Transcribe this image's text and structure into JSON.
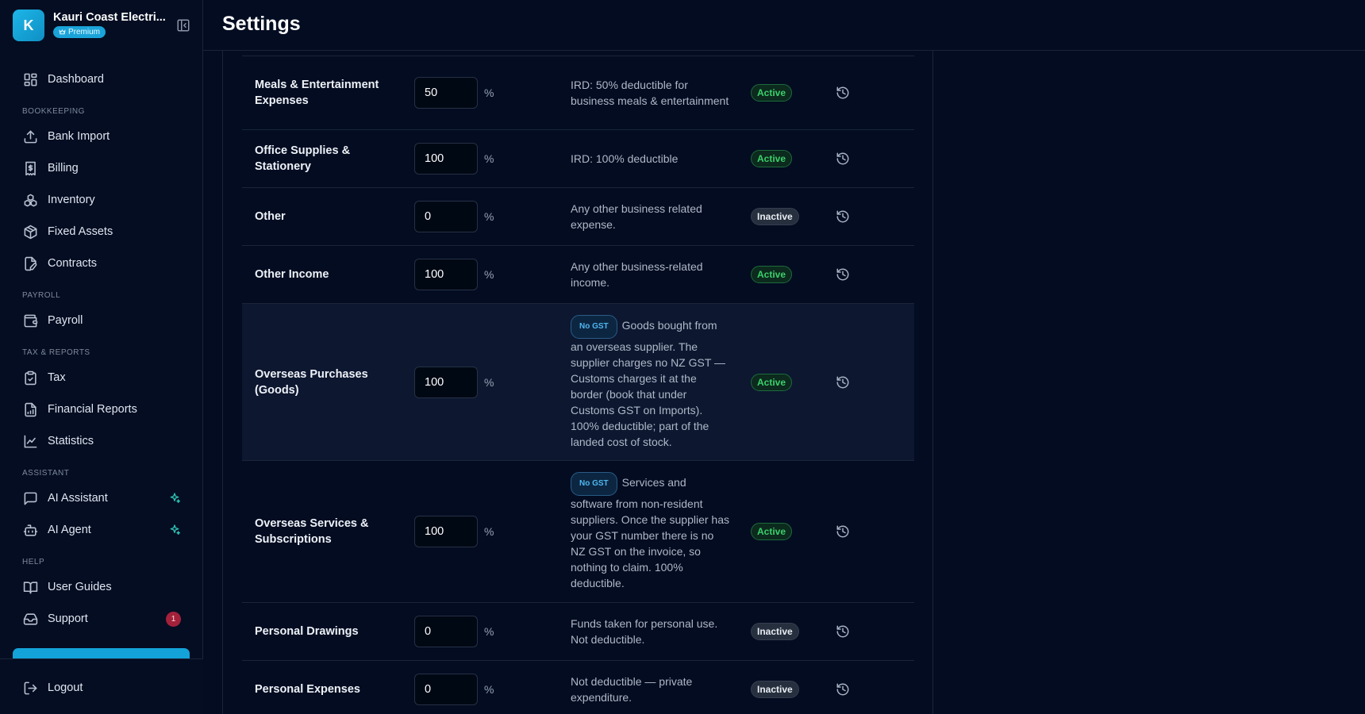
{
  "brand": {
    "initial": "K",
    "name": "Kauri Coast Electri...",
    "plan": "Premium"
  },
  "header": {
    "title": "Settings"
  },
  "nav": {
    "dashboard": "Dashboard",
    "sections": {
      "bookkeeping": "BOOKKEEPING",
      "payroll": "PAYROLL",
      "tax_reports": "TAX & REPORTS",
      "assistant": "ASSISTANT",
      "help": "HELP"
    },
    "bank_import": "Bank Import",
    "billing": "Billing",
    "inventory": "Inventory",
    "fixed_assets": "Fixed Assets",
    "contracts": "Contracts",
    "payroll": "Payroll",
    "tax": "Tax",
    "financial_reports": "Financial Reports",
    "statistics": "Statistics",
    "ai_assistant": "AI Assistant",
    "ai_agent": "AI Agent",
    "user_guides": "User Guides",
    "support": "Support",
    "support_badge": "1",
    "logout": "Logout"
  },
  "percent_sign": "%",
  "rows": [
    {
      "category": "Meals & Entertainment Expenses",
      "percent": "50",
      "tag": "",
      "note": "IRD: 50% deductible for business meals & entertainment",
      "status": "Active"
    },
    {
      "category": "Office Supplies & Stationery",
      "percent": "100",
      "tag": "",
      "note": "IRD: 100% deductible",
      "status": "Active"
    },
    {
      "category": "Other",
      "percent": "0",
      "tag": "",
      "note": "Any other business related expense.",
      "status": "Inactive"
    },
    {
      "category": "Other Income",
      "percent": "100",
      "tag": "",
      "note": "Any other business-related income.",
      "status": "Active"
    },
    {
      "category": "Overseas Purchases (Goods)",
      "percent": "100",
      "tag": "No GST",
      "note": "Goods bought from an overseas supplier. The supplier charges no NZ GST — Customs charges it at the border (book that under Customs GST on Imports). 100% deductible; part of the landed cost of stock.",
      "status": "Active"
    },
    {
      "category": "Overseas Services & Subscriptions",
      "percent": "100",
      "tag": "No GST",
      "note": "Services and software from non-resident suppliers. Once the supplier has your GST number there is no NZ GST on the invoice, so nothing to claim. 100% deductible.",
      "status": "Active"
    },
    {
      "category": "Personal Drawings",
      "percent": "0",
      "tag": "",
      "note": "Funds taken for personal use. Not deductible.",
      "status": "Inactive"
    },
    {
      "category": "Personal Expenses",
      "percent": "0",
      "tag": "",
      "note": "Not deductible — private expenditure.",
      "status": "Inactive"
    }
  ],
  "colors": {
    "accent": "#1aa3d9",
    "active": "#3bd06c",
    "background": "#030c21"
  }
}
